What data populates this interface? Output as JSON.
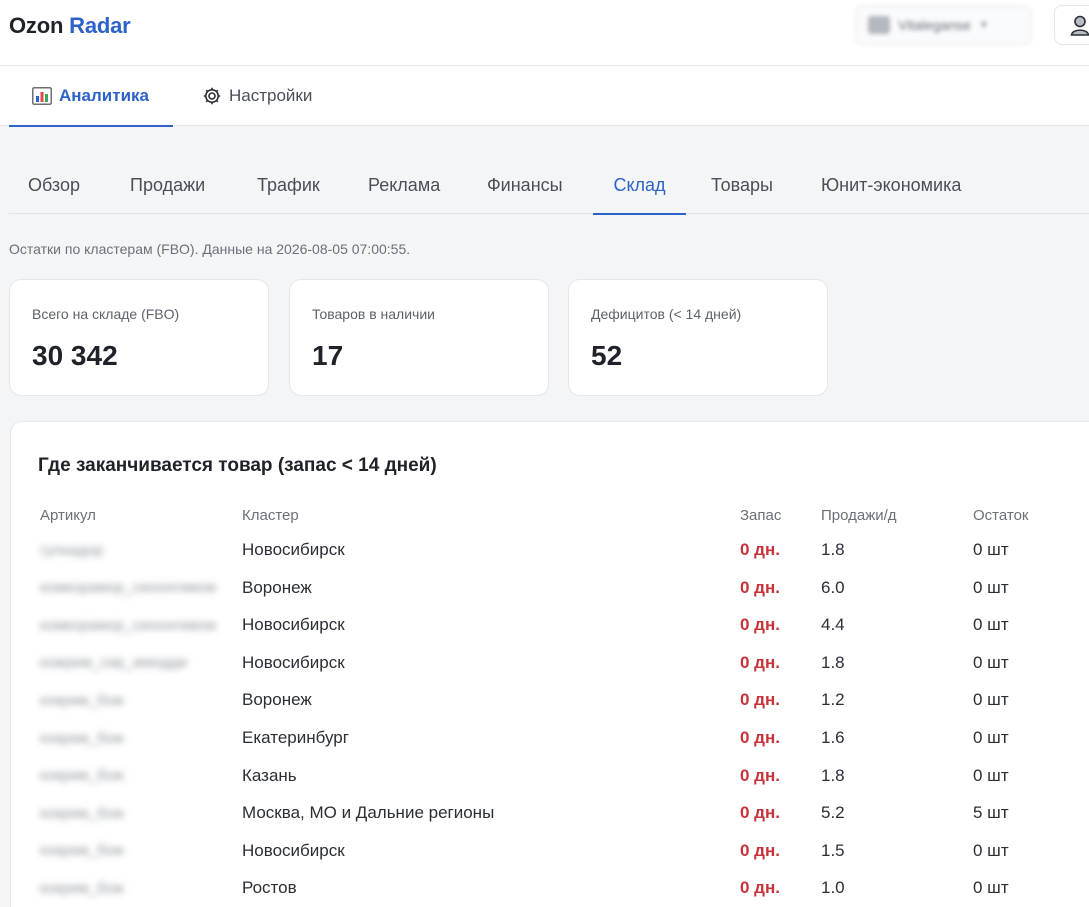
{
  "header": {
    "logo_part1": "Ozon",
    "logo_part2": "Radar",
    "account_name": "Vitaleganse"
  },
  "main_tabs": [
    {
      "label": "Аналитика",
      "icon": "bar-chart-icon",
      "active": true
    },
    {
      "label": "Настройки",
      "icon": "gear-icon",
      "active": false
    }
  ],
  "sub_tabs": [
    {
      "label": "Обзор",
      "active": false
    },
    {
      "label": "Продажи",
      "active": false
    },
    {
      "label": "Трафик",
      "active": false
    },
    {
      "label": "Реклама",
      "active": false
    },
    {
      "label": "Финансы",
      "active": false
    },
    {
      "label": "Склад",
      "active": true
    },
    {
      "label": "Товары",
      "active": false
    },
    {
      "label": "Юнит-экономика",
      "active": false
    }
  ],
  "note": "Остатки по кластерам (FBO). Данные на 2026-08-05 07:00:55.",
  "kpis": [
    {
      "label": "Всего на складе (FBO)",
      "value": "30 342"
    },
    {
      "label": "Товаров в наличии",
      "value": "17"
    },
    {
      "label": "Дефицитов (< 14 дней)",
      "value": "52"
    }
  ],
  "table": {
    "title": "Где заканчивается товар (запас < 14 дней)",
    "columns": [
      "Артикул",
      "Кластер",
      "Запас",
      "Продажи/д",
      "Остаток"
    ],
    "rows": [
      {
        "sku": "гулнадор",
        "cluster": "Новосибирск",
        "stock": "0 дн.",
        "sales": "1.8",
        "rest": "0 шт"
      },
      {
        "sku": "комкорамор_синонгимом",
        "cluster": "Воронеж",
        "stock": "0 дн.",
        "sales": "6.0",
        "rest": "0 шт"
      },
      {
        "sku": "комкорамор_синонгимом",
        "cluster": "Новосибирск",
        "stock": "0 дн.",
        "sales": "4.4",
        "rest": "0 шт"
      },
      {
        "sku": "кожрим_сир_жмодди",
        "cluster": "Новосибирск",
        "stock": "0 дн.",
        "sales": "1.8",
        "rest": "0 шт"
      },
      {
        "sku": "кокрим_бож",
        "cluster": "Воронеж",
        "stock": "0 дн.",
        "sales": "1.2",
        "rest": "0 шт"
      },
      {
        "sku": "кокрим_бож",
        "cluster": "Екатеринбург",
        "stock": "0 дн.",
        "sales": "1.6",
        "rest": "0 шт"
      },
      {
        "sku": "кокрим_бож",
        "cluster": "Казань",
        "stock": "0 дн.",
        "sales": "1.8",
        "rest": "0 шт"
      },
      {
        "sku": "кокрим_бож",
        "cluster": "Москва, МО и Дальние регионы",
        "stock": "0 дн.",
        "sales": "5.2",
        "rest": "5 шт"
      },
      {
        "sku": "кокрим_бож",
        "cluster": "Новосибирск",
        "stock": "0 дн.",
        "sales": "1.5",
        "rest": "0 шт"
      },
      {
        "sku": "кокрим_бож",
        "cluster": "Ростов",
        "stock": "0 дн.",
        "sales": "1.0",
        "rest": "0 шт"
      }
    ]
  },
  "colors": {
    "accent": "#2d63c8",
    "deficit": "#c8323a",
    "background": "#f3f5f7"
  }
}
